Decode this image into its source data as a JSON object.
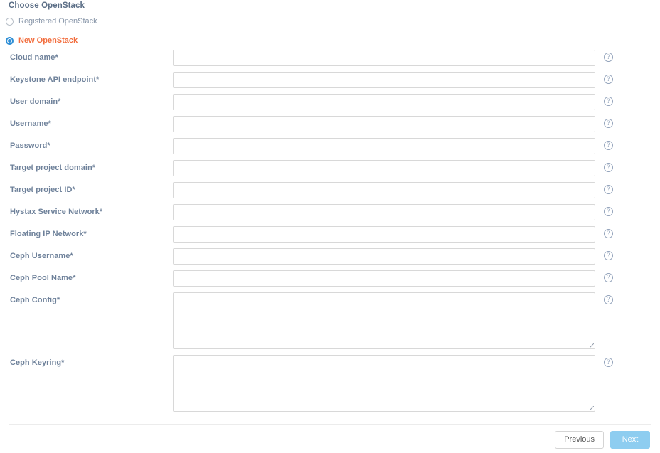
{
  "page": {
    "title": "Choose OpenStack"
  },
  "radio_group": {
    "name": "openstack-choice",
    "options": [
      {
        "label": "Registered OpenStack",
        "selected": false
      },
      {
        "label": "New OpenStack",
        "selected": true
      }
    ]
  },
  "form": {
    "help_icon_glyph": "?",
    "help_icon_name": "help-circle-icon",
    "fields": [
      {
        "label": "Cloud name*",
        "type": "text",
        "value": "",
        "placeholder": ""
      },
      {
        "label": "Keystone API endpoint*",
        "type": "text",
        "value": "",
        "placeholder": ""
      },
      {
        "label": "User domain*",
        "type": "text",
        "value": "",
        "placeholder": ""
      },
      {
        "label": "Username*",
        "type": "text",
        "value": "",
        "placeholder": ""
      },
      {
        "label": "Password*",
        "type": "password",
        "value": "",
        "placeholder": ""
      },
      {
        "label": "Target project domain*",
        "type": "text",
        "value": "",
        "placeholder": ""
      },
      {
        "label": "Target project ID*",
        "type": "text",
        "value": "",
        "placeholder": ""
      },
      {
        "label": "Hystax Service Network*",
        "type": "text",
        "value": "",
        "placeholder": ""
      },
      {
        "label": "Floating IP Network*",
        "type": "text",
        "value": "",
        "placeholder": ""
      },
      {
        "label": "Ceph Username*",
        "type": "text",
        "value": "",
        "placeholder": ""
      },
      {
        "label": "Ceph Pool Name*",
        "type": "text",
        "value": "",
        "placeholder": ""
      },
      {
        "label": "Ceph Config*",
        "type": "textarea",
        "value": "",
        "placeholder": ""
      },
      {
        "label": "Ceph Keyring*",
        "type": "textarea",
        "value": "",
        "placeholder": ""
      }
    ]
  },
  "footer": {
    "previous_label": "Previous",
    "next_label": "Next"
  },
  "colors": {
    "accent_orange": "#f26d3d",
    "radio_blue": "#2f8fd6",
    "primary_button": "#8ecdf0",
    "label_text": "#6e819a",
    "input_border": "#d8d8d8"
  }
}
